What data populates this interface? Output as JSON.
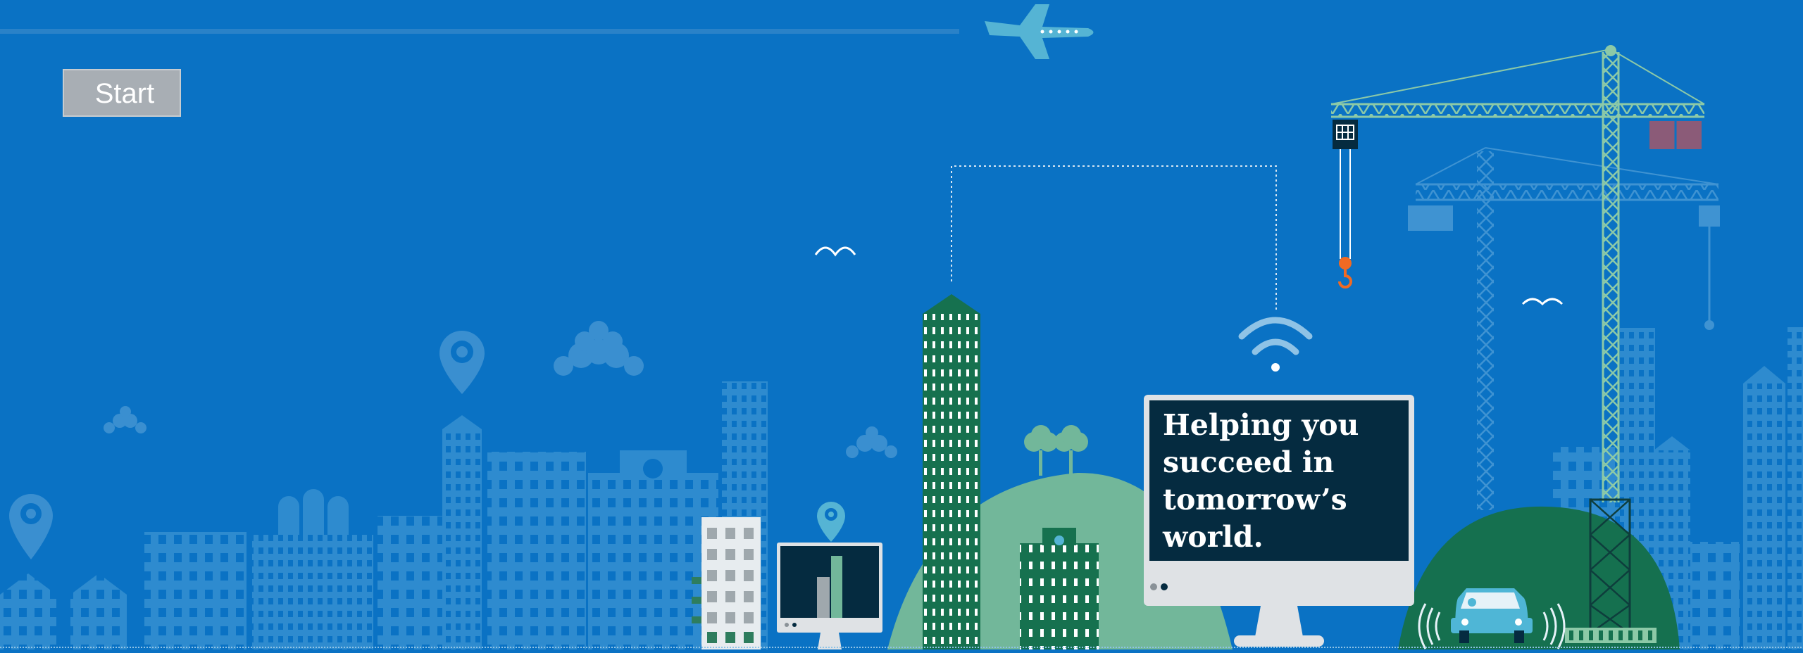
{
  "app": {
    "start_button_label": "Start",
    "headline": "Helping you succeed in tomorrow’s world."
  },
  "colors": {
    "sky": "#0a72c4",
    "building_light": "#2e8bcf",
    "building_dark_green": "#16714f",
    "hill_light": "#72b79a",
    "hill_dark": "#15704f",
    "crane": "#8cc9a7",
    "crane_faded": "#3a8dcf",
    "hook_orange": "#f06a23",
    "monitor_frame": "#dfe2e5",
    "monitor_screen": "#052b40",
    "car": "#4fb6d6",
    "cargo_box": "#8b5b78"
  },
  "icons": [
    "airplane-icon",
    "location-pin-icon",
    "wifi-icon",
    "bird-icon",
    "cloud-icon",
    "tree-icon",
    "car-icon",
    "crane-hook-icon"
  ]
}
